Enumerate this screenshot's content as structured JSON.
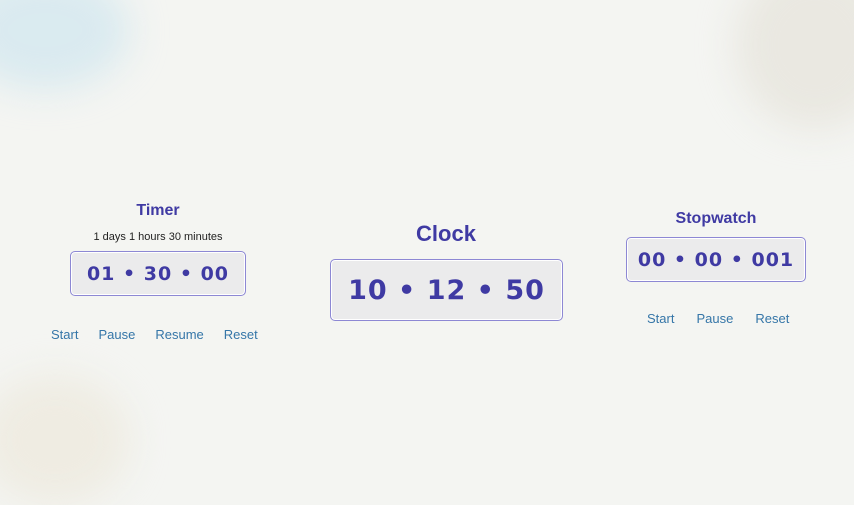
{
  "timer": {
    "title": "Timer",
    "remaining_text": "1 days 1 hours 30 minutes",
    "display": "01 • 30 • 00",
    "controls": {
      "start": "Start",
      "pause": "Pause",
      "resume": "Resume",
      "reset": "Reset"
    }
  },
  "clock": {
    "title": "Clock",
    "display": "10 • 12 • 50"
  },
  "stopwatch": {
    "title": "Stopwatch",
    "display": "00 • 00 • 001",
    "controls": {
      "start": "Start",
      "pause": "Pause",
      "reset": "Reset"
    }
  },
  "colors": {
    "title": "#3f3aa3",
    "display_border": "#8d88d4",
    "display_bg": "#ebebec",
    "control_link": "#3576a8",
    "background": "#f4f5f2"
  }
}
